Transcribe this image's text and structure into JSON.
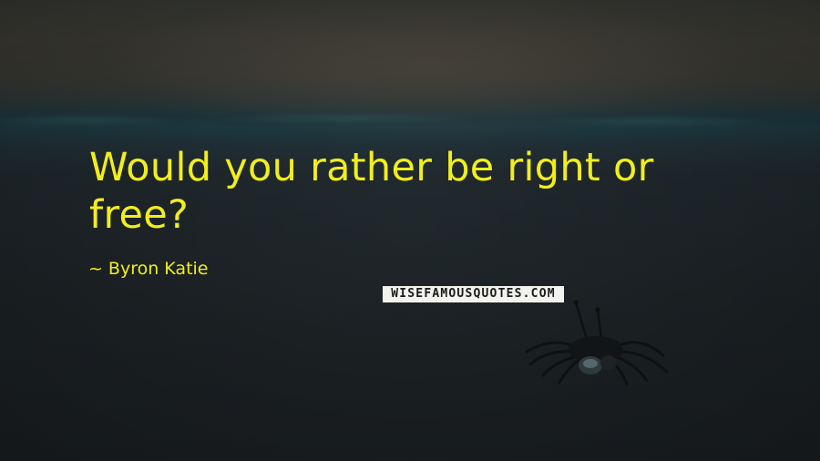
{
  "quote": {
    "text": "Would you rather be right or free?",
    "text_color": "#f2ee1c"
  },
  "author": {
    "dash": "~",
    "name": "Byron Katie"
  },
  "watermark": {
    "text": "WISEFAMOUSQUOTES.COM"
  },
  "background": {
    "subject": "crab-on-beach-at-dusk"
  }
}
